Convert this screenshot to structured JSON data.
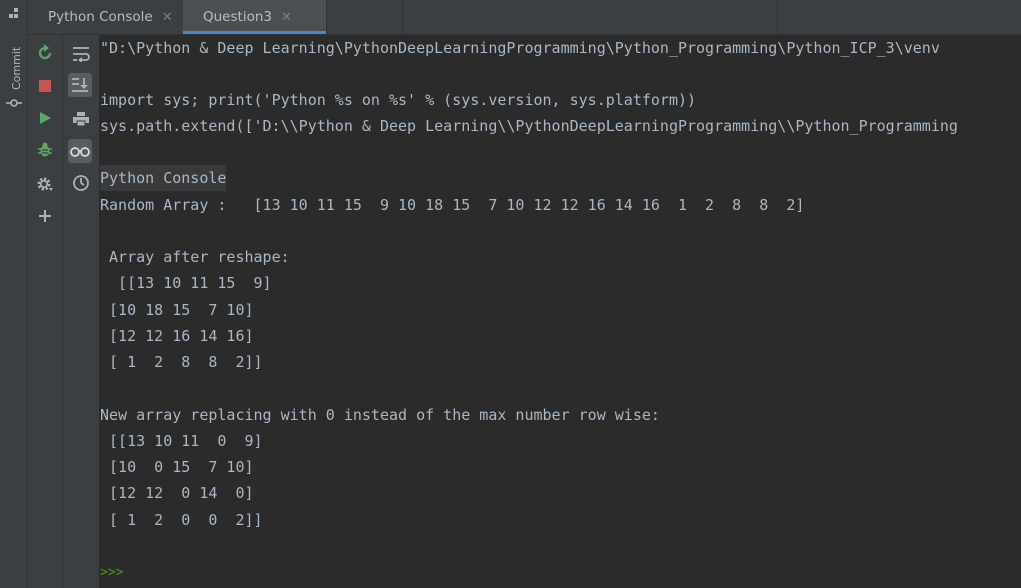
{
  "tabs": [
    {
      "label": "Python Console",
      "active": false
    },
    {
      "label": "Question3",
      "active": true
    }
  ],
  "left_strip": {
    "commit_label": "Commit"
  },
  "toolbar_primary": [
    {
      "icon": "rerun-icon",
      "color": "#59a869"
    },
    {
      "icon": "stop-icon",
      "color": "#c75450"
    },
    {
      "icon": "run-icon",
      "color": "#59a869"
    },
    {
      "icon": "debug-icon",
      "color": "#59a869"
    },
    {
      "icon": "settings-icon",
      "color": "#afb1b3"
    },
    {
      "icon": "add-icon",
      "color": "#afb1b3"
    }
  ],
  "toolbar_secondary": [
    {
      "icon": "soft-wrap-icon"
    },
    {
      "icon": "scroll-to-end-icon",
      "active": true
    },
    {
      "icon": "print-icon"
    },
    {
      "icon": "variables-view-icon",
      "active": true
    },
    {
      "icon": "history-icon"
    }
  ],
  "console": {
    "lines": [
      "\"D:\\Python & Deep Learning\\PythonDeepLearningProgramming\\Python_Programming\\Python_ICP_3\\venv",
      "",
      "import sys; print('Python %s on %s' % (sys.version, sys.platform))",
      "sys.path.extend(['D:\\\\Python & Deep Learning\\\\PythonDeepLearningProgramming\\\\Python_Programming",
      "",
      "Python Console",
      "Random Array :   [13 10 11 15  9 10 18 15  7 10 12 12 16 14 16  1  2  8  8  2]",
      "",
      " Array after reshape:",
      "  [[13 10 11 15  9]",
      " [10 18 15  7 10]",
      " [12 12 16 14 16]",
      " [ 1  2  8  8  2]]",
      "",
      "New array replacing with 0 instead of the max number row wise:",
      " [[13 10 11  0  9]",
      " [10  0 15  7 10]",
      " [12 12  0 14  0]",
      " [ 1  2  0  0  2]]",
      "",
      ""
    ],
    "prompt": ">>>"
  },
  "colors": {
    "background": "#2b2b2b",
    "panel": "#3c3f41",
    "text": "#a9b7c6",
    "accent": "#4a88c7",
    "prompt": "#4e9a06"
  }
}
